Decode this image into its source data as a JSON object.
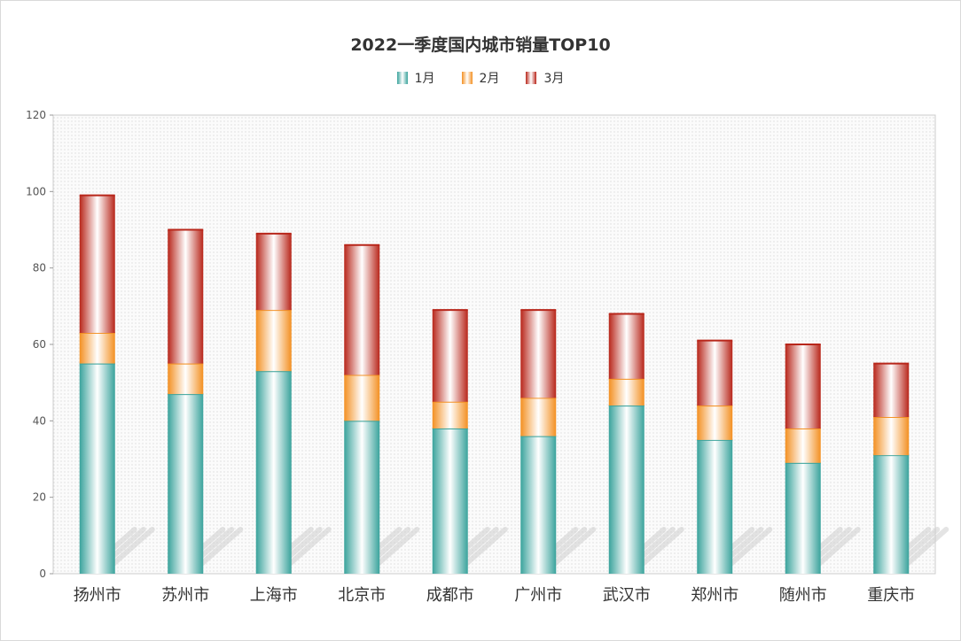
{
  "chart_data": {
    "type": "bar",
    "stacked": true,
    "title": "2022一季度国内城市销量TOP10",
    "categories": [
      "扬州市",
      "苏州市",
      "上海市",
      "北京市",
      "成都市",
      "广州市",
      "武汉市",
      "郑州市",
      "随州市",
      "重庆市"
    ],
    "series": [
      {
        "name": "1月",
        "values": [
          55,
          47,
          53,
          40,
          38,
          36,
          44,
          35,
          29,
          31
        ],
        "color": "#3aa39c"
      },
      {
        "name": "2月",
        "values": [
          8,
          8,
          16,
          12,
          7,
          10,
          7,
          9,
          9,
          10
        ],
        "color": "#f39022"
      },
      {
        "name": "3月",
        "values": [
          36,
          35,
          20,
          34,
          24,
          23,
          17,
          17,
          22,
          14
        ],
        "color": "#b8261a"
      }
    ],
    "ylim": [
      0,
      120
    ],
    "yticks": [
      0,
      20,
      40,
      60,
      80,
      100,
      120
    ],
    "legend_position": "top-center",
    "grid": false
  }
}
